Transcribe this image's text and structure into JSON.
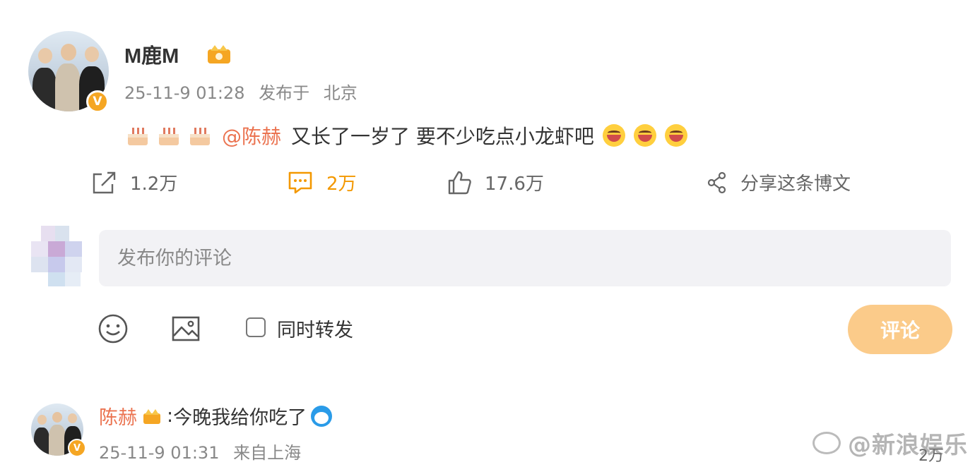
{
  "post": {
    "username": "M鹿M",
    "time": "25-11-9 01:28",
    "posted_from_label": "发布于",
    "location": "北京",
    "mention": "@陈赫",
    "text": "又长了一岁了 要不少吃点小龙虾吧",
    "actions": {
      "repost_count": "1.2万",
      "comment_count": "2万",
      "like_count": "17.6万",
      "share_label": "分享这条博文"
    },
    "icons": [
      "birthday-cake-icon",
      "grin-emoji-icon",
      "crown-badge-icon",
      "verified-v-icon"
    ]
  },
  "composer": {
    "placeholder": "发布你的评论",
    "forward_label": "同时转发",
    "submit_label": "评论"
  },
  "reply": {
    "username": "陈赫",
    "separator": ":",
    "text": "今晚我给你吃了",
    "time": "25-11-9 01:31",
    "source": "来自上海",
    "like_count": "2万"
  },
  "watermark": "@新浪娱乐",
  "colors": {
    "accent_orange": "#f39800",
    "mention": "#eb7350",
    "submit_bg": "#fbcb8a",
    "verified": "#f5a623"
  }
}
